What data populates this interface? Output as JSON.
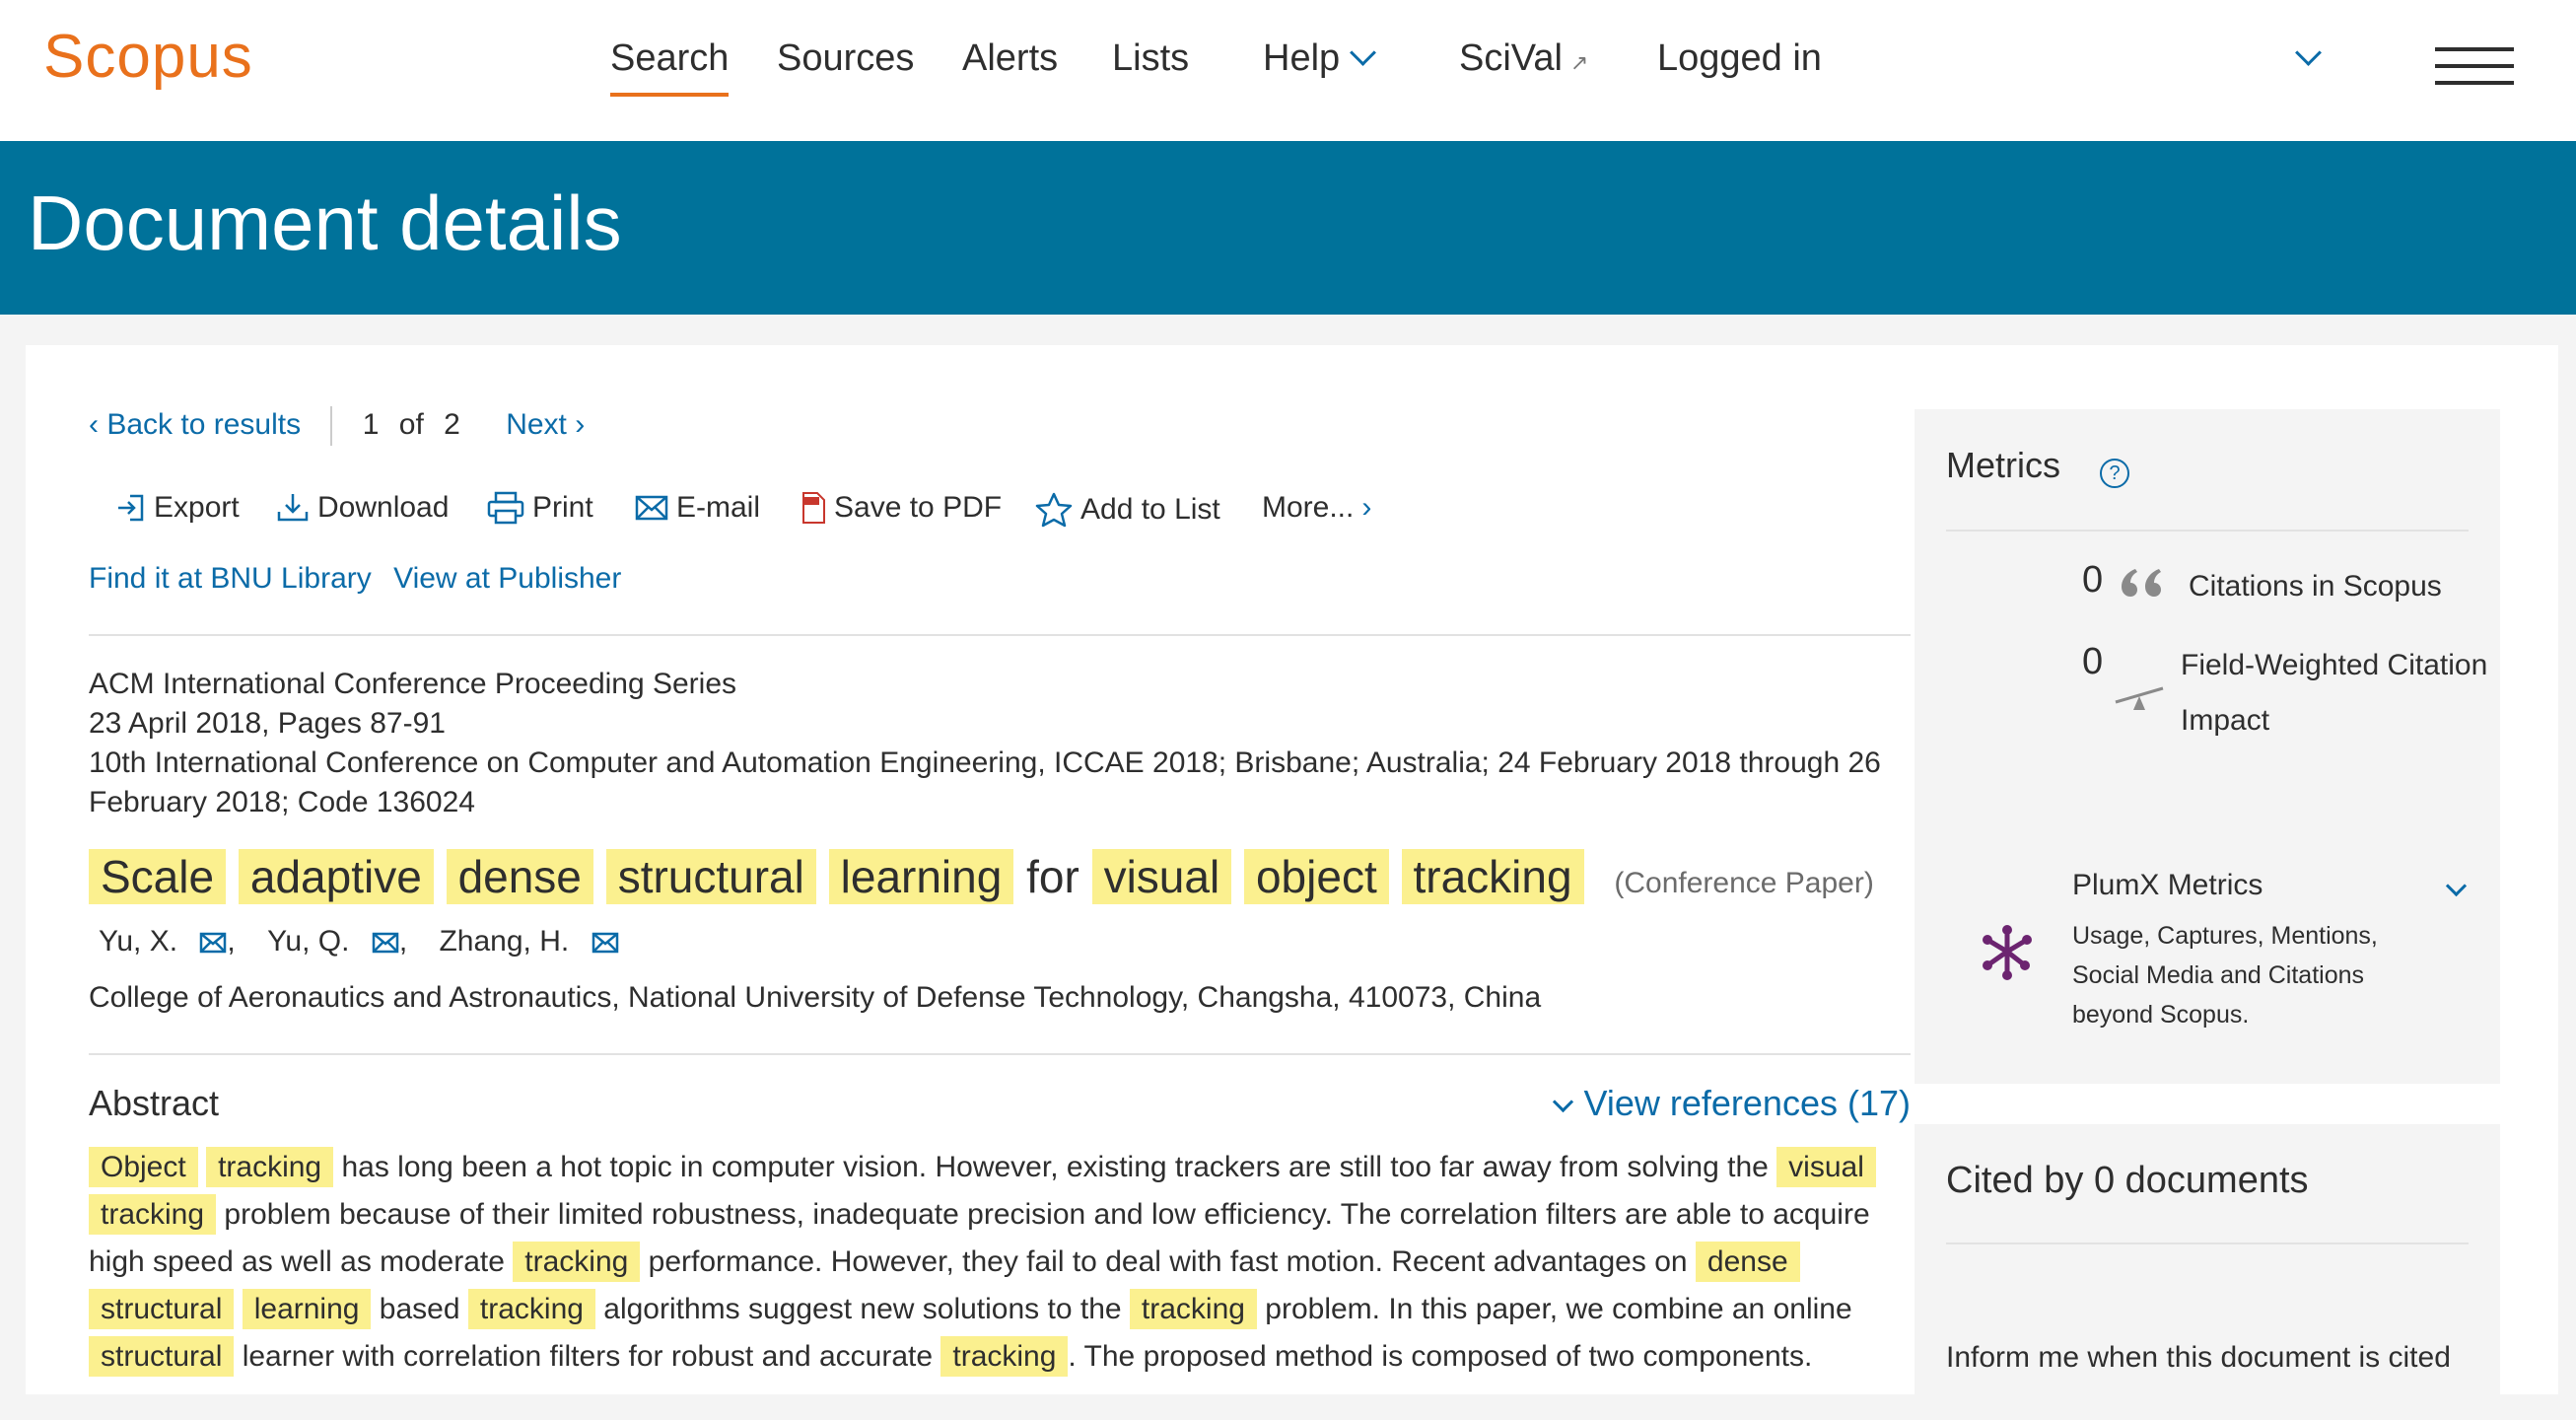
{
  "header": {
    "logo": "Scopus",
    "nav": [
      {
        "label": "Search"
      },
      {
        "label": "Sources"
      },
      {
        "label": "Alerts"
      },
      {
        "label": "Lists"
      },
      {
        "label": "Help"
      },
      {
        "label": "SciVal"
      },
      {
        "label": "Logged in"
      }
    ]
  },
  "banner": {
    "title": "Document details"
  },
  "pager": {
    "back": "Back to results",
    "current": "1",
    "of": "of",
    "total": "2",
    "next": "Next"
  },
  "toolbar": {
    "export": "Export",
    "download": "Download",
    "print": "Print",
    "email": "E-mail",
    "pdf": "Save to PDF",
    "add_list": "Add to List",
    "more": "More..."
  },
  "links": {
    "find": "Find it at BNU Library",
    "publisher": "View at Publisher"
  },
  "source": {
    "series": "ACM International Conference Proceeding Series",
    "date_pages": "23 April 2018, Pages 87-91",
    "conference": "10th International Conference on Computer and Automation Engineering, ICCAE 2018; Brisbane; Australia; 24 February 2018 through 26 February 2018; Code 136024"
  },
  "document": {
    "title_words": [
      "Scale",
      "adaptive",
      "dense",
      "structural",
      "learning",
      "for",
      "visual",
      "object",
      "tracking"
    ],
    "type": "(Conference Paper)",
    "authors": [
      "Yu, X.",
      "Yu, Q.",
      "Zhang, H."
    ],
    "affiliation": "College of Aeronautics and Astronautics, National University of Defense Technology, Changsha, 410073, China"
  },
  "abstract": {
    "heading": "Abstract",
    "view_references": "View references (17)",
    "segments": [
      {
        "t": "Object",
        "h": true
      },
      {
        "t": " ",
        "h": false
      },
      {
        "t": "tracking",
        "h": true
      },
      {
        "t": " has long been a hot topic in computer vision. However, existing trackers are still too far away from solving the ",
        "h": false
      },
      {
        "t": "visual",
        "h": true
      },
      {
        "t": " ",
        "h": false
      },
      {
        "t": "tracking",
        "h": true
      },
      {
        "t": " problem because of their limited robustness, inadequate precision and low efficiency. The correlation filters are able to acquire high speed as well as moderate ",
        "h": false
      },
      {
        "t": "tracking",
        "h": true
      },
      {
        "t": " performance. However, they fail to deal with fast motion. Recent advantages on ",
        "h": false
      },
      {
        "t": "dense",
        "h": true
      },
      {
        "t": " ",
        "h": false
      },
      {
        "t": "structural",
        "h": true
      },
      {
        "t": " ",
        "h": false
      },
      {
        "t": "learning",
        "h": true
      },
      {
        "t": " based ",
        "h": false
      },
      {
        "t": "tracking",
        "h": true
      },
      {
        "t": " algorithms suggest new solutions to the ",
        "h": false
      },
      {
        "t": "tracking",
        "h": true
      },
      {
        "t": " problem. In this paper, we combine an online ",
        "h": false
      },
      {
        "t": "structural",
        "h": true
      },
      {
        "t": " learner with correlation filters for robust and accurate ",
        "h": false
      },
      {
        "t": "tracking",
        "h": true
      },
      {
        "t": ". The proposed method is composed of two components.",
        "h": false
      }
    ]
  },
  "metrics": {
    "heading": "Metrics",
    "citations_value": "0",
    "citations_label": "Citations in Scopus",
    "fwci_value": "0",
    "fwci_label_1": "Field-Weighted Citation",
    "fwci_label_2": "Impact",
    "plumx_title": "PlumX Metrics",
    "plumx_desc_1": "Usage, Captures, Mentions,",
    "plumx_desc_2": "Social Media and Citations",
    "plumx_desc_3": "beyond Scopus."
  },
  "cited_by": {
    "heading": "Cited by 0 documents",
    "inform": "Inform me when this document is cited"
  },
  "colors": {
    "brand_orange": "#e9711c",
    "banner_blue": "#00729a",
    "link_blue": "#0b6ba8",
    "highlight": "#fbf08f"
  }
}
